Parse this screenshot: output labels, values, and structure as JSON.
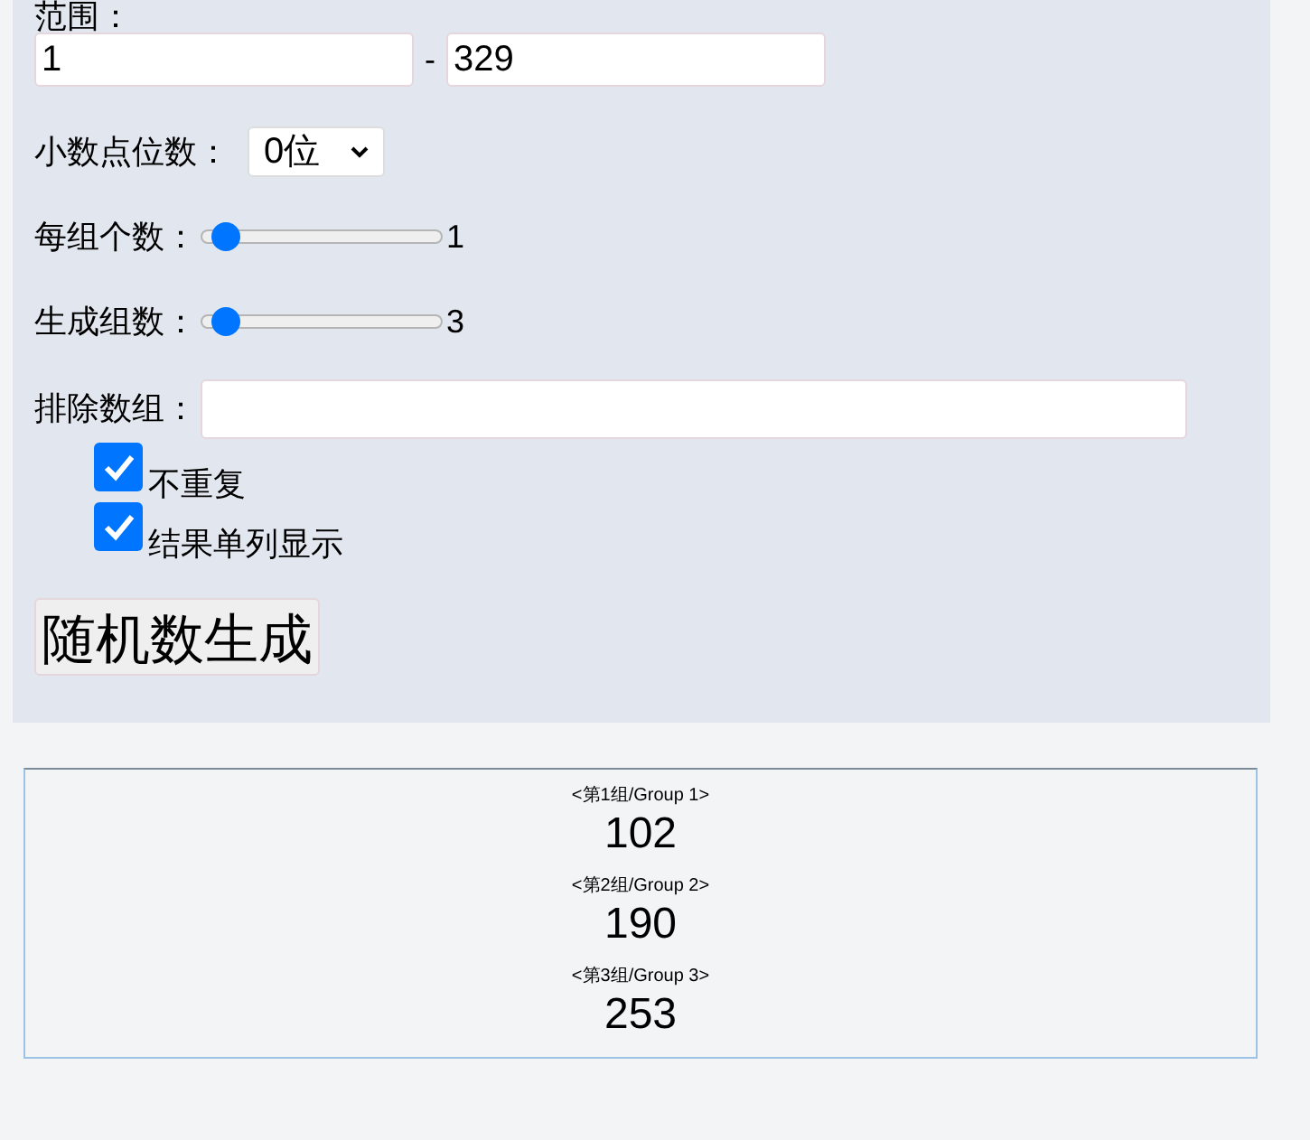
{
  "range": {
    "label": "范围：",
    "from": "1",
    "separator": "-",
    "to": "329"
  },
  "decimals": {
    "label": "小数点位数：",
    "value": "0位"
  },
  "sliders": [
    {
      "label": "每组个数：",
      "level": 0.05,
      "reading": "1"
    },
    {
      "label": "生成组数：",
      "level": 0.05,
      "reading": "3"
    }
  ],
  "exclude": {
    "label": "排除数组："
  },
  "options": [
    {
      "label": "不重复",
      "checked": true
    },
    {
      "label": "结果单列显示",
      "checked": true
    }
  ],
  "generate_button": "随机数生成",
  "results": [
    {
      "label": "<第1组/Group 1>",
      "value": "102"
    },
    {
      "label": "<第2组/Group 2>",
      "value": "190"
    },
    {
      "label": "<第3组/Group 3>",
      "value": "253"
    }
  ]
}
